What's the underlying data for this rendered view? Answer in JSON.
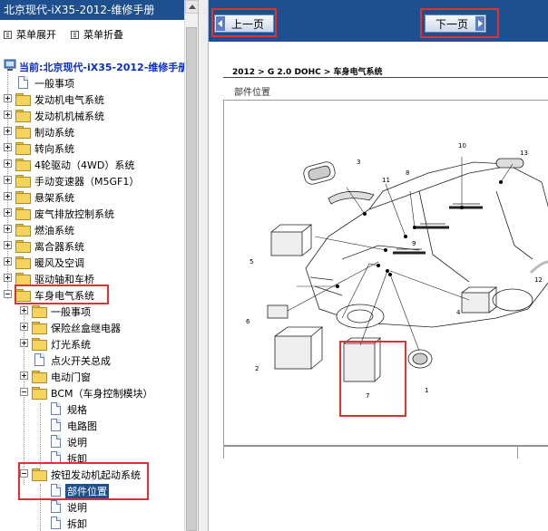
{
  "left_pane": {
    "title": "北京现代-iX35-2012-维修手册",
    "menu_expand": "菜单展开",
    "menu_collapse": "菜单折叠",
    "root_label": "当前:北京现代-iX35-2012-维修手册",
    "tree": [
      {
        "label": "一般事项",
        "icon": "doc-icon"
      },
      {
        "label": "发动机电气系统",
        "icon": "folder-icon"
      },
      {
        "label": "发动机机械系统",
        "icon": "folder-icon"
      },
      {
        "label": "制动系统",
        "icon": "folder-icon"
      },
      {
        "label": "转向系统",
        "icon": "folder-icon"
      },
      {
        "label": "4轮驱动（4WD）系统",
        "icon": "folder-icon"
      },
      {
        "label": "手动变速器（M5GF1）",
        "icon": "folder-icon"
      },
      {
        "label": "悬架系统",
        "icon": "folder-icon"
      },
      {
        "label": "废气排放控制系统",
        "icon": "folder-icon"
      },
      {
        "label": "燃油系统",
        "icon": "folder-icon"
      },
      {
        "label": "离合器系统",
        "icon": "folder-icon"
      },
      {
        "label": "暖风及空调",
        "icon": "folder-icon"
      },
      {
        "label": "驱动轴和车桥",
        "icon": "folder-icon"
      },
      {
        "label": "车身电气系统",
        "icon": "folder-open-icon"
      },
      {
        "label": "一般事项",
        "icon": "folder-icon"
      },
      {
        "label": "保险丝盒继电器",
        "icon": "folder-icon"
      },
      {
        "label": "灯光系统",
        "icon": "folder-icon"
      },
      {
        "label": "点火开关总成",
        "icon": "doc-icon"
      },
      {
        "label": "电动门窗",
        "icon": "folder-icon"
      },
      {
        "label": "BCM（车身控制模块）",
        "icon": "folder-open-icon"
      },
      {
        "label": "规格",
        "icon": "doc-icon"
      },
      {
        "label": "电路图",
        "icon": "doc-icon"
      },
      {
        "label": "说明",
        "icon": "doc-icon"
      },
      {
        "label": "拆卸",
        "icon": "doc-icon"
      },
      {
        "label": "按钮发动机起动系统",
        "icon": "folder-open-icon"
      },
      {
        "label": "部件位置",
        "icon": "doc-icon",
        "selected": true
      },
      {
        "label": "说明",
        "icon": "doc-icon"
      },
      {
        "label": "拆卸",
        "icon": "doc-icon"
      }
    ]
  },
  "right_pane": {
    "prev_label": "上一页",
    "next_label": "下一页",
    "breadcrumb": "2012 > G 2.0 DOHC > 车身电气系统",
    "section_title": "部件位置",
    "callouts": [
      "1",
      "2",
      "3",
      "4",
      "5",
      "6",
      "7",
      "8",
      "9",
      "10",
      "11",
      "12",
      "13"
    ]
  },
  "colors": {
    "header_blue": "#1e4f8e",
    "highlight_red": "#e53030",
    "root_label_blue": "#0a2cc8"
  }
}
